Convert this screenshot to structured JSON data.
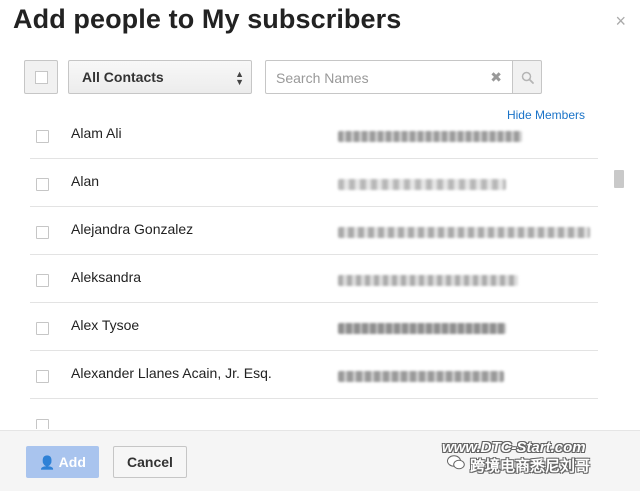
{
  "dialog": {
    "title": "Add people to My subscribers",
    "close_icon": "×"
  },
  "toolbar": {
    "filter_selected": "All Contacts",
    "search_placeholder": "Search Names",
    "clear_icon": "✖"
  },
  "hide_members_label": "Hide Members",
  "contacts": [
    {
      "name": "Alam Ali"
    },
    {
      "name": "Alan"
    },
    {
      "name": "Alejandra Gonzalez"
    },
    {
      "name": "Aleksandra"
    },
    {
      "name": "Alex Tysoe"
    },
    {
      "name": "Alexander Llanes Acain, Jr. Esq."
    },
    {
      "name": ""
    }
  ],
  "footer": {
    "add_label": "Add",
    "cancel_label": "Cancel"
  },
  "watermark": {
    "line1": "www.DTC-Start.com",
    "line2": "跨境电商悉尼刘哥"
  },
  "colors": {
    "link": "#1a73c8",
    "add_button_disabled": "#a9c4ee"
  }
}
